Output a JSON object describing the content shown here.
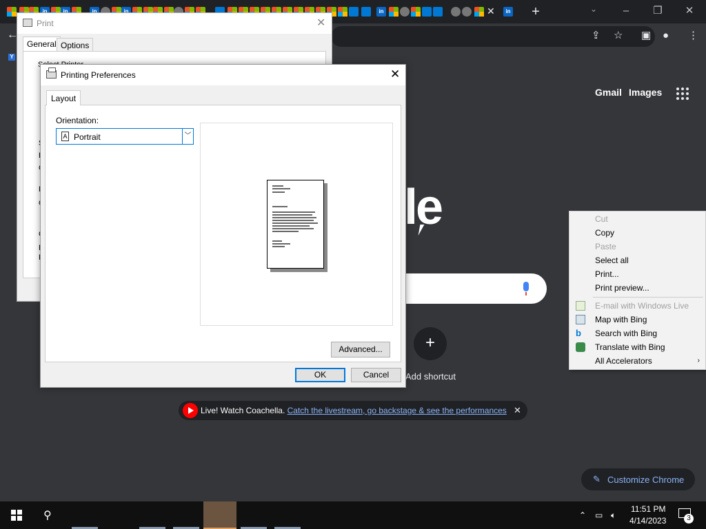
{
  "chrome": {
    "ntp": {
      "gmail": "Gmail",
      "images": "Images",
      "logo_partial": "le",
      "add_shortcut": "Add shortcut",
      "promo": {
        "text": "Live! Watch Coachella.",
        "link": "Catch the livestream, go backstage & see the performances"
      },
      "customize": "Customize Chrome"
    }
  },
  "print_dialog": {
    "title": "Print",
    "tabs": [
      "General",
      "Options"
    ],
    "fragments": [
      "Select Printer",
      "S",
      "L",
      "C",
      "R",
      "C",
      "C",
      "E",
      "P"
    ]
  },
  "printing_preferences": {
    "title": "Printing Preferences",
    "tab": "Layout",
    "orientation_label": "Orientation:",
    "orientation_value": "Portrait",
    "portrait_icon_glyph": "A",
    "advanced": "Advanced...",
    "ok": "OK",
    "cancel": "Cancel"
  },
  "context_menu": {
    "items": [
      {
        "label": "Cut",
        "enabled": false
      },
      {
        "label": "Copy",
        "enabled": true
      },
      {
        "label": "Paste",
        "enabled": false
      },
      {
        "label": "Select all",
        "enabled": true
      },
      {
        "label": "Print...",
        "enabled": true
      },
      {
        "label": "Print preview...",
        "enabled": true
      },
      {
        "label": "E-mail with Windows Live",
        "enabled": false
      },
      {
        "label": "Map with Bing",
        "enabled": true
      },
      {
        "label": "Search with Bing",
        "enabled": true
      },
      {
        "label": "Translate with Bing",
        "enabled": true
      },
      {
        "label": "All Accelerators",
        "enabled": true
      }
    ]
  },
  "taskbar": {
    "time": "11:51 PM",
    "date": "4/14/2023",
    "notification_count": "3"
  },
  "colors": {
    "chrome_dark": "#35363a",
    "link_blue": "#8ab4f8",
    "dialog_bg": "#f0f0f0",
    "focus_blue": "#0078d7"
  }
}
